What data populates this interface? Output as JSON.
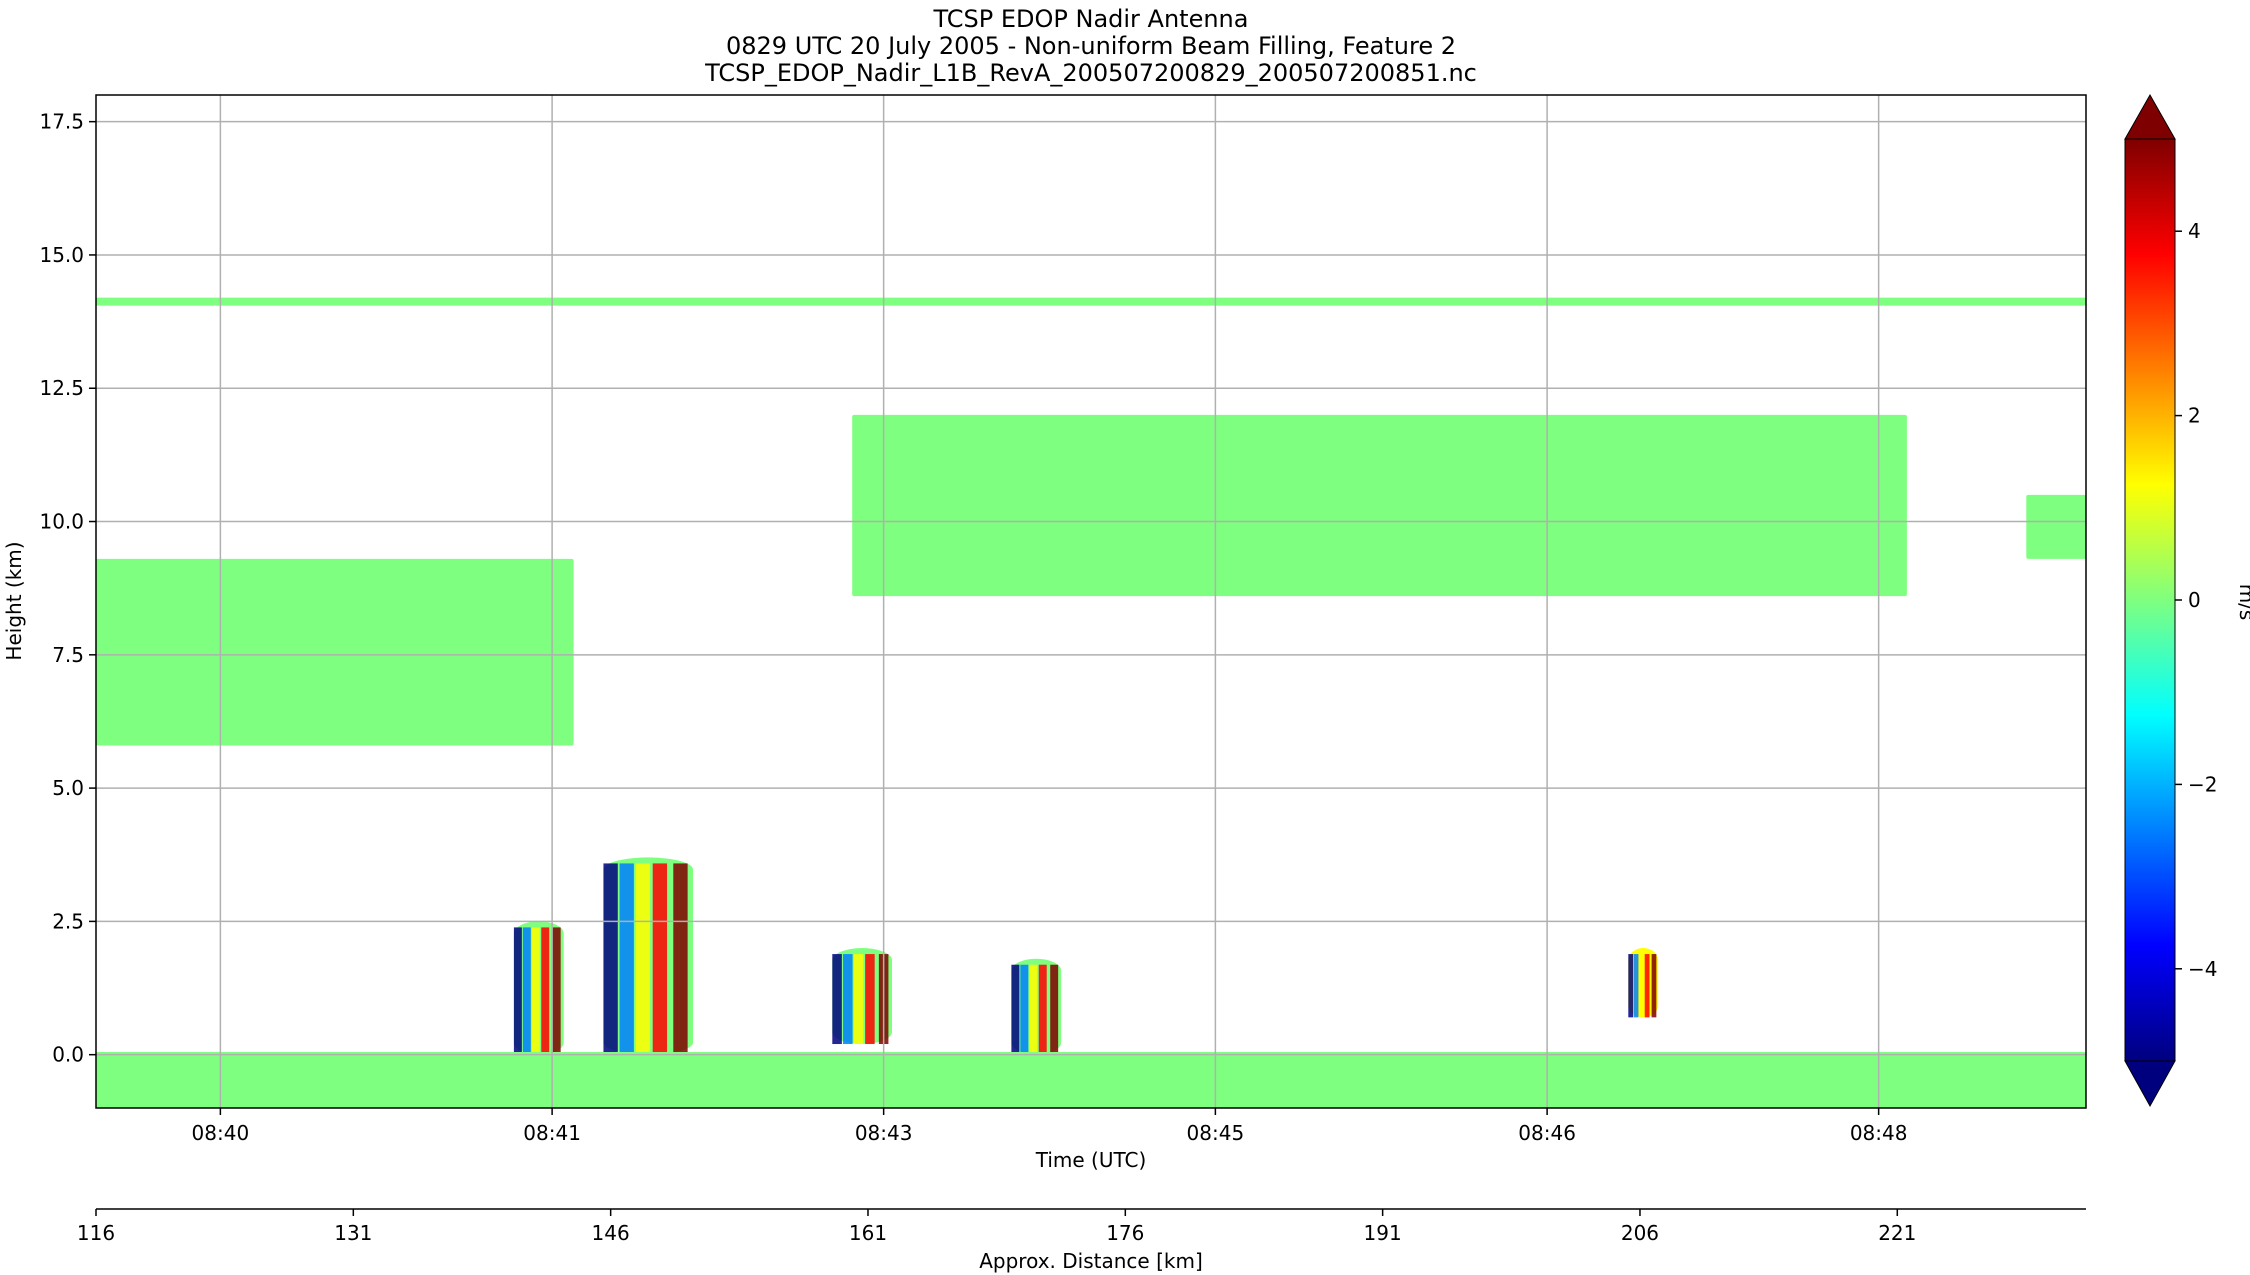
{
  "chart_data": {
    "type": "heatmap",
    "title_lines": [
      "TCSP EDOP Nadir Antenna",
      "0829 UTC 20 July 2005 - Non-uniform Beam Filling, Feature 2",
      "TCSP_EDOP_Nadir_L1B_RevA_200507200829_200507200851.nc"
    ],
    "xlabel": "Time (UTC)",
    "ylabel": "Height (km)",
    "x2label": "Approx. Distance [km]",
    "colorbar_label": "m/s",
    "x_ticks": [
      "08:40",
      "08:41",
      "08:43",
      "08:45",
      "08:46",
      "08:48"
    ],
    "x_tick_pos": [
      0.0625,
      0.2292,
      0.3958,
      0.5625,
      0.7292,
      0.8958
    ],
    "x2_ticks": [
      "116",
      "131",
      "146",
      "161",
      "176",
      "191",
      "206",
      "221"
    ],
    "x2_lim": [
      116,
      232
    ],
    "y_ticks": [
      "0.0",
      "2.5",
      "5.0",
      "7.5",
      "10.0",
      "12.5",
      "15.0",
      "17.5"
    ],
    "y_tick_values": [
      0,
      2.5,
      5,
      7.5,
      10,
      12.5,
      15,
      17.5
    ],
    "ylim": [
      -1,
      18
    ],
    "cbar_ticks": [
      "−4",
      "−2",
      "0",
      "2",
      "4"
    ],
    "cbar_tick_values": [
      -4,
      -2,
      0,
      2,
      4
    ],
    "clim": [
      -5,
      5
    ],
    "colormap": [
      "#00007f",
      "#0000ff",
      "#007fff",
      "#00ffff",
      "#7fff7f",
      "#ffff00",
      "#ff7f00",
      "#ff0000",
      "#7f0000"
    ],
    "grid": true,
    "features": [
      {
        "name": "tropopause-layer",
        "x": [
          0,
          1
        ],
        "y": [
          14.05,
          14.2
        ],
        "v": 0.1
      },
      {
        "name": "anvil-left",
        "x": [
          0,
          0.24
        ],
        "y": [
          5.8,
          9.3
        ],
        "v": 0.3
      },
      {
        "name": "anvil-right",
        "x": [
          0.38,
          0.91
        ],
        "y": [
          8.6,
          12.0
        ],
        "v": 0.1
      },
      {
        "name": "cloud-far-right",
        "x": [
          0.97,
          1
        ],
        "y": [
          9.3,
          10.5
        ],
        "v": 0.4
      },
      {
        "name": "cell-1",
        "x": [
          0.21,
          0.235
        ],
        "y": [
          0,
          2.5
        ],
        "v": 0.0
      },
      {
        "name": "cell-2",
        "x": [
          0.255,
          0.3
        ],
        "y": [
          0,
          3.7
        ],
        "v": 0.0
      },
      {
        "name": "cell-3",
        "x": [
          0.37,
          0.4
        ],
        "y": [
          0.2,
          2.0
        ],
        "v": 0.5
      },
      {
        "name": "cell-4",
        "x": [
          0.46,
          0.485
        ],
        "y": [
          0,
          1.8
        ],
        "v": 0.0
      },
      {
        "name": "cell-5",
        "x": [
          0.77,
          0.785
        ],
        "y": [
          0.7,
          2.0
        ],
        "v": 1.0
      },
      {
        "name": "surface-return",
        "x": [
          0,
          1
        ],
        "y": [
          -1,
          0.05
        ],
        "v": 0.1
      }
    ]
  }
}
